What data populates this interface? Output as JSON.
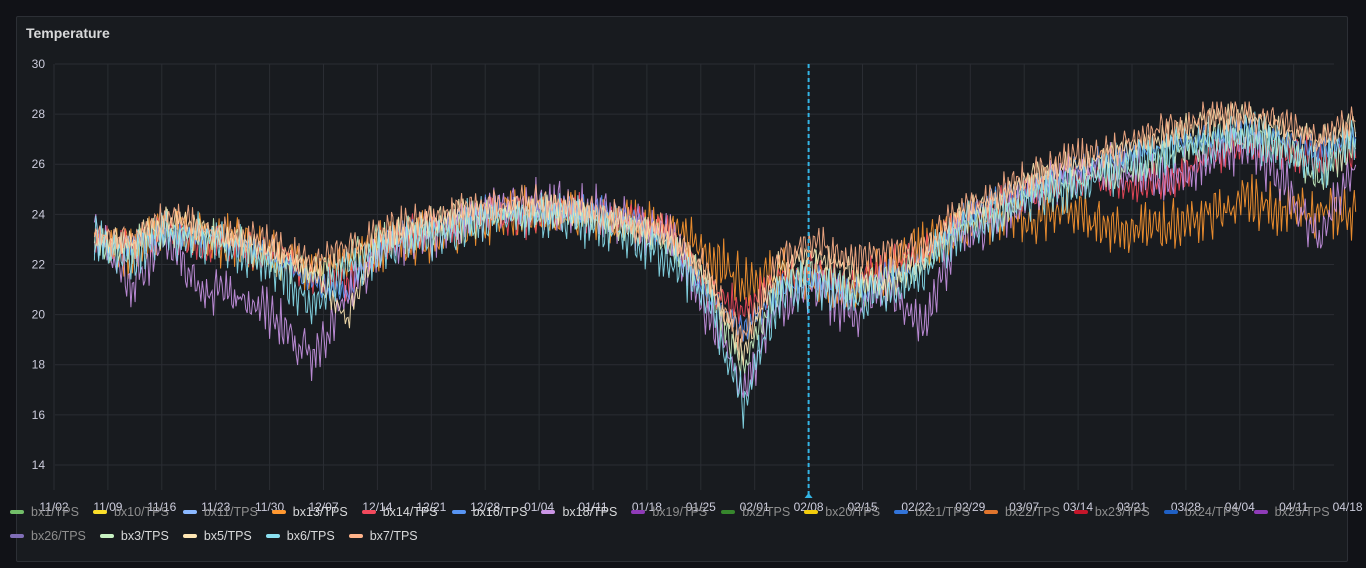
{
  "panel": {
    "title": "Temperature"
  },
  "chart_data": {
    "type": "line",
    "title": "Temperature",
    "ylim": [
      13,
      30
    ],
    "y_ticks": [
      14,
      16,
      18,
      20,
      22,
      24,
      26,
      28,
      30
    ],
    "x_tick_labels": [
      "11/02",
      "11/09",
      "11/16",
      "11/23",
      "11/30",
      "12/07",
      "12/14",
      "12/21",
      "12/28",
      "01/04",
      "01/11",
      "01/18",
      "01/25",
      "02/01",
      "02/08",
      "02/15",
      "02/22",
      "02/29",
      "03/07",
      "03/14",
      "03/21",
      "03/28",
      "04/04",
      "04/11",
      "04/18"
    ],
    "x_start_label": "11/02",
    "x_data_start_tick": 0.75,
    "x_data_end_tick": 24.15,
    "crosshair_tick": 14.0,
    "grid": true,
    "legend_position": "bottom",
    "series": [
      {
        "name": "bx1/TPS",
        "color": "#73bf69",
        "active": false,
        "values": []
      },
      {
        "name": "bx10/TPS",
        "color": "#fade2a",
        "active": false,
        "values": []
      },
      {
        "name": "bx11/TPS",
        "color": "#8ab8ff",
        "active": false,
        "values": []
      },
      {
        "name": "bx13/TPS",
        "color": "#ff9830",
        "active": true,
        "values": [
          23.2,
          22.4,
          23.6,
          23.0,
          22.9,
          22.5,
          21.8,
          21.9,
          22.8,
          23.1,
          23.3,
          23.8,
          24.1,
          23.9,
          24.0,
          23.7,
          23.5,
          22.4,
          21.4,
          21.6,
          21.3,
          21.1,
          21.8,
          22.7,
          23.5,
          23.9,
          23.7,
          24.2,
          23.6,
          23.4,
          23.6,
          24.0,
          24.5,
          24.2,
          24.0,
          24.1
        ]
      },
      {
        "name": "bx14/TPS",
        "color": "#f2495c",
        "active": true,
        "values": [
          23.0,
          22.6,
          23.4,
          22.8,
          22.7,
          22.3,
          21.5,
          21.2,
          22.9,
          23.3,
          23.6,
          24.0,
          23.8,
          24.2,
          23.9,
          23.9,
          23.2,
          21.0,
          20.2,
          21.4,
          21.8,
          21.2,
          22.0,
          22.4,
          23.7,
          24.3,
          24.9,
          25.3,
          25.4,
          25.1,
          25.5,
          26.3,
          26.9,
          26.6,
          26.2,
          26.5
        ]
      },
      {
        "name": "bx16/TPS",
        "color": "#5794f2",
        "active": true,
        "values": [
          22.6,
          22.9,
          23.1,
          23.2,
          22.8,
          22.4,
          21.3,
          20.8,
          23.0,
          23.5,
          23.8,
          24.3,
          24.0,
          24.3,
          24.2,
          23.8,
          22.9,
          20.8,
          19.4,
          21.0,
          21.5,
          20.9,
          21.6,
          22.2,
          23.9,
          24.6,
          25.1,
          25.8,
          26.2,
          26.5,
          26.8,
          27.1,
          27.3,
          27.0,
          26.6,
          27.1
        ]
      },
      {
        "name": "bx18/TPS",
        "color": "#ca95e5",
        "active": true,
        "values": [
          23.4,
          21.2,
          23.0,
          21.0,
          20.8,
          19.9,
          18.3,
          20.6,
          22.6,
          23.1,
          23.5,
          24.2,
          24.4,
          24.3,
          24.1,
          23.6,
          23.1,
          20.2,
          17.0,
          20.4,
          21.1,
          20.0,
          21.2,
          19.6,
          23.3,
          23.6,
          24.8,
          25.5,
          25.9,
          25.6,
          25.4,
          26.2,
          26.8,
          25.3,
          23.0,
          26.0
        ]
      },
      {
        "name": "bx19/TPS",
        "color": "#8f3bb8",
        "active": false,
        "values": []
      },
      {
        "name": "bx2/TPS",
        "color": "#37872d",
        "active": false,
        "values": []
      },
      {
        "name": "bx20/TPS",
        "color": "#f2cc0c",
        "active": false,
        "values": []
      },
      {
        "name": "bx21/TPS",
        "color": "#3274d9",
        "active": false,
        "values": []
      },
      {
        "name": "bx22/TPS",
        "color": "#e0752d",
        "active": false,
        "values": []
      },
      {
        "name": "bx23/TPS",
        "color": "#c4162a",
        "active": false,
        "values": []
      },
      {
        "name": "bx24/TPS",
        "color": "#1f60c4",
        "active": false,
        "values": []
      },
      {
        "name": "bx25/TPS",
        "color": "#8f3bb8",
        "active": false,
        "values": []
      },
      {
        "name": "bx26/TPS",
        "color": "#806eb7",
        "active": false,
        "values": []
      },
      {
        "name": "bx3/TPS",
        "color": "#c8f2c2",
        "active": true,
        "values": [
          22.8,
          22.7,
          23.5,
          23.2,
          22.9,
          22.1,
          21.6,
          22.3,
          23.0,
          23.3,
          23.6,
          23.9,
          24.1,
          24.0,
          23.8,
          23.4,
          22.8,
          21.3,
          17.8,
          21.2,
          21.9,
          21.0,
          21.5,
          22.0,
          23.6,
          24.1,
          24.9,
          25.2,
          25.6,
          26.0,
          26.5,
          27.0,
          27.2,
          26.8,
          25.4,
          26.9
        ]
      },
      {
        "name": "bx5/TPS",
        "color": "#ffe7b3",
        "active": true,
        "values": [
          23.1,
          22.9,
          23.8,
          23.4,
          23.0,
          22.6,
          21.9,
          19.8,
          23.2,
          23.6,
          24.0,
          24.2,
          24.3,
          24.2,
          23.9,
          23.5,
          23.0,
          21.5,
          18.4,
          22.0,
          22.5,
          21.8,
          21.0,
          22.3,
          24.0,
          24.6,
          25.6,
          25.9,
          26.3,
          26.8,
          27.3,
          27.8,
          27.9,
          27.4,
          26.9,
          27.6
        ]
      },
      {
        "name": "bx6/TPS",
        "color": "#8ae0f0",
        "active": true,
        "values": [
          22.9,
          22.3,
          23.3,
          23.0,
          22.6,
          21.8,
          20.4,
          21.6,
          22.7,
          23.2,
          23.4,
          23.8,
          23.9,
          23.8,
          23.6,
          23.1,
          22.3,
          20.6,
          16.4,
          20.8,
          21.3,
          20.5,
          20.8,
          21.8,
          23.4,
          24.0,
          24.7,
          25.1,
          25.7,
          26.1,
          26.6,
          27.0,
          27.1,
          26.7,
          25.8,
          27.2
        ]
      },
      {
        "name": "bx7/TPS",
        "color": "#ffb38a",
        "active": true,
        "values": [
          23.3,
          22.8,
          23.9,
          23.5,
          23.1,
          22.7,
          22.0,
          22.6,
          23.3,
          23.7,
          24.1,
          24.4,
          24.5,
          24.4,
          24.1,
          23.6,
          23.2,
          21.7,
          18.9,
          22.3,
          22.9,
          22.1,
          22.4,
          22.6,
          24.2,
          24.8,
          25.5,
          26.1,
          26.6,
          27.0,
          27.5,
          27.9,
          28.0,
          27.6,
          27.0,
          27.7
        ]
      }
    ]
  },
  "legend": {
    "rows": [
      [
        0,
        1,
        2,
        3,
        4,
        5,
        6,
        7,
        8,
        9,
        10,
        11,
        12,
        13,
        14
      ],
      [
        15,
        16,
        17,
        18,
        19
      ]
    ]
  }
}
